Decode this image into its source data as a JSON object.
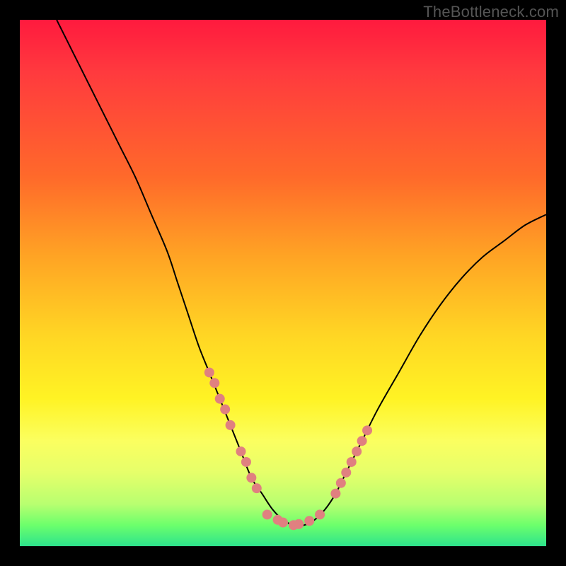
{
  "watermark": "TheBottleneck.com",
  "chart_data": {
    "type": "line",
    "title": "",
    "xlabel": "",
    "ylabel": "",
    "xlim": [
      0,
      100
    ],
    "ylim": [
      0,
      100
    ],
    "series": [
      {
        "name": "bottleneck-curve",
        "x": [
          7,
          10,
          13,
          16,
          19,
          22,
          25,
          28,
          30,
          32,
          34,
          36,
          38,
          40,
          42,
          44,
          46,
          48,
          50,
          52,
          54,
          56,
          58,
          60,
          62,
          65,
          68,
          72,
          76,
          80,
          84,
          88,
          92,
          96,
          100
        ],
        "y": [
          100,
          94,
          88,
          82,
          76,
          70,
          63,
          56,
          50,
          44,
          38,
          33,
          28,
          23,
          18,
          13,
          10,
          7,
          5,
          4,
          4,
          5,
          7,
          10,
          14,
          20,
          26,
          33,
          40,
          46,
          51,
          55,
          58,
          61,
          63
        ]
      }
    ],
    "marker_clusters": [
      {
        "name": "left-branch-markers",
        "x": [
          36,
          37,
          38,
          39,
          40,
          42,
          43,
          44,
          45
        ],
        "y": [
          33,
          31,
          28,
          26,
          23,
          18,
          16,
          13,
          11
        ]
      },
      {
        "name": "valley-markers",
        "x": [
          47,
          49,
          50,
          52,
          53,
          55,
          57
        ],
        "y": [
          6,
          5,
          4.5,
          4,
          4.2,
          4.8,
          6
        ]
      },
      {
        "name": "right-branch-markers",
        "x": [
          60,
          61,
          62,
          63,
          64,
          65,
          66
        ],
        "y": [
          10,
          12,
          14,
          16,
          18,
          20,
          22
        ]
      }
    ],
    "marker_radius": 7
  }
}
